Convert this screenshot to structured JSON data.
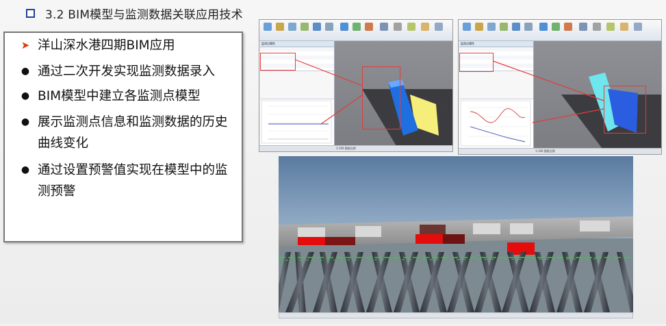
{
  "slide": {
    "section_title": "3.2 BIM模型与监测数据关联应用技术",
    "bullets": [
      {
        "marker": "arrow",
        "text": "洋山深水港四期BIM应用"
      },
      {
        "marker": "dot",
        "text": "通过二次开发实现监测数据录入"
      },
      {
        "marker": "dot",
        "text": "BIM模型中建立各监测点模型"
      },
      {
        "marker": "dot",
        "text": "展示监测点信息和监测数据的历史曲线变化"
      },
      {
        "marker": "dot",
        "text": "通过设置预警值实现在模型中的监测预警"
      }
    ]
  },
  "screenshot_left": {
    "panel_title": "监测点属性",
    "status_text": "1:100  图纸比例"
  },
  "screenshot_right": {
    "panel_title": "监测点属性",
    "status_text": "1:100  图纸比例"
  },
  "scene_viewer": {
    "status_text": ""
  },
  "colors": {
    "title_bullet": "#1f3f9a",
    "arrow_marker": "#e03a10",
    "highlight_box": "#e23b3b",
    "monitor_point_blue": "#1f6fe0",
    "monitor_point_yellow": "#f6ee7a",
    "monitor_point_cyan": "#6fe6ee",
    "warning_red": "#e50c0c",
    "label_green": "#2bd12b"
  }
}
